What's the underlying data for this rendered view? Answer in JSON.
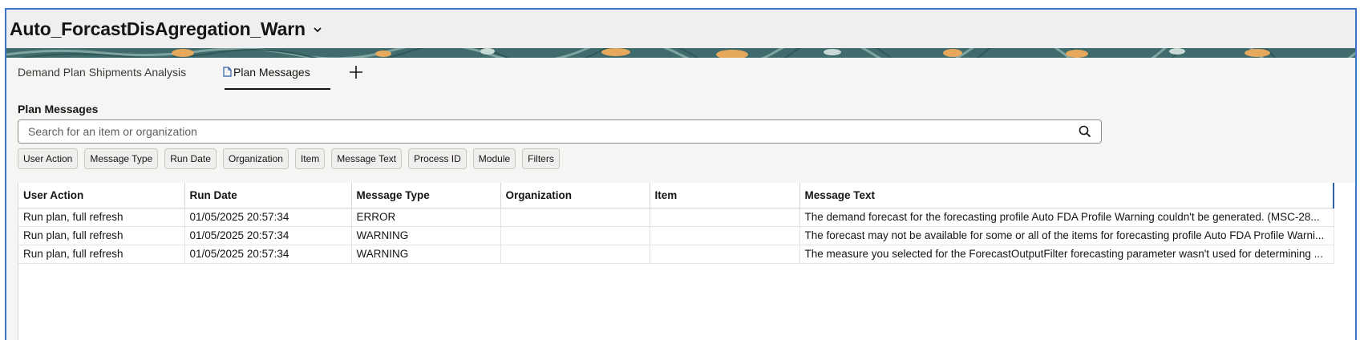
{
  "page": {
    "title": "Auto_ForcastDisAgregation_Warn"
  },
  "tabs": [
    {
      "label": "Demand Plan Shipments Analysis"
    },
    {
      "label": "Plan Messages"
    }
  ],
  "icons": {
    "title_chevron": "chevron-down-icon",
    "tab_doc": "document-icon",
    "add_tab": "plus-icon",
    "search": "search-icon"
  },
  "colors": {
    "frame_border": "#3e74c9",
    "banner_base": "#3f6b6c",
    "banner_accent": "#e6a85c",
    "active_column_marker": "#2c5ea8"
  },
  "section": {
    "title": "Plan Messages"
  },
  "search": {
    "placeholder": "Search for an item or organization",
    "value": ""
  },
  "filter_chips": [
    "User Action",
    "Message Type",
    "Run Date",
    "Organization",
    "Item",
    "Message Text",
    "Process ID",
    "Module",
    "Filters"
  ],
  "table": {
    "columns": [
      "User Action",
      "Run Date",
      "Message Type",
      "Organization",
      "Item",
      "Message Text"
    ],
    "rows": [
      [
        "Run plan, full refresh",
        "01/05/2025 20:57:34",
        "ERROR",
        "",
        "",
        "The demand forecast for the forecasting profile Auto FDA Profile Warning couldn't be generated. (MSC-28..."
      ],
      [
        "Run plan, full refresh",
        "01/05/2025 20:57:34",
        "WARNING",
        "",
        "",
        "The forecast may not be available for some or all of the items for forecasting profile Auto FDA Profile Warni..."
      ],
      [
        "Run plan, full refresh",
        "01/05/2025 20:57:34",
        "WARNING",
        "",
        "",
        "The measure you selected for the ForecastOutputFilter forecasting parameter wasn't used for determining ..."
      ]
    ]
  }
}
